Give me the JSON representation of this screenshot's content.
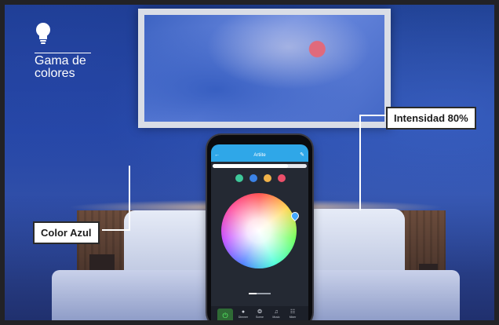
{
  "brand": {
    "line1": "Gama de",
    "line2": "colores",
    "icon": "lightbulb-icon"
  },
  "callouts": {
    "intensity": "Intensidad 80%",
    "color": "Color Azul"
  },
  "app": {
    "title": "Artiite",
    "back_icon": "←",
    "edit_icon": "✎",
    "brightness_level": 0.8,
    "swatch_colors": [
      "#3ec89a",
      "#3b82e6",
      "#f0b24a",
      "#ec4f6a"
    ],
    "tabs": [
      {
        "label": "Dimmer",
        "icon": "●"
      },
      {
        "label": "Scene",
        "icon": "❂"
      },
      {
        "label": "Music",
        "icon": "♫"
      },
      {
        "label": "Mixer",
        "icon": "☷"
      }
    ],
    "power_icon": "⏻"
  },
  "colors": {
    "accent": "#2fa7e8",
    "screen_bg": "#242933",
    "power_bg": "#2f6b35"
  }
}
